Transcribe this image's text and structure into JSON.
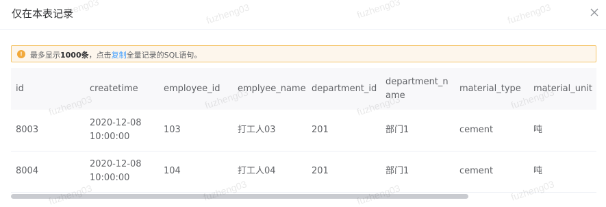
{
  "dialog": {
    "title": "仅在本表记录",
    "close_icon": "close-icon"
  },
  "notice": {
    "icon": "warning-circle-icon",
    "prefix": "最多显示",
    "count": "1000条",
    "middle": "，点击",
    "link": "复制",
    "suffix": "全量记录的SQL语句。"
  },
  "table": {
    "columns": [
      "id",
      "createtime",
      "employee_id",
      "emplyee_name",
      "department_id",
      "department_name",
      "material_type",
      "material_unit"
    ],
    "rows": [
      [
        "8003",
        "2020-12-08 10:00:00",
        "103",
        "打工人03",
        "201",
        "部门1",
        "cement",
        "吨"
      ],
      [
        "8004",
        "2020-12-08 10:00:00",
        "104",
        "打工人04",
        "201",
        "部门1",
        "cement",
        "吨"
      ]
    ]
  },
  "watermark": "fuzheng03",
  "colors": {
    "accent": "#409eff",
    "warning": "#f2a93b",
    "warning_bg": "#fdf6ec"
  }
}
